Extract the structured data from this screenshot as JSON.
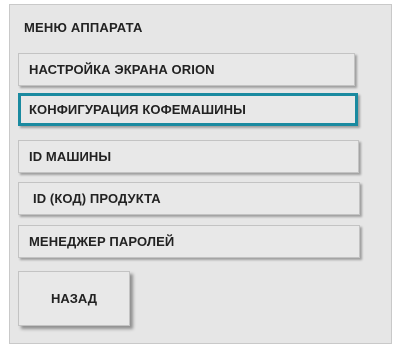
{
  "menu": {
    "title": "МЕНЮ АППАРАТА",
    "items": [
      {
        "label": "НАСТРОЙКА ЭКРАНА ORION",
        "selected": false
      },
      {
        "label": "КОНФИГУРАЦИЯ КОФЕМАШИНЫ",
        "selected": true
      },
      {
        "label": "ID МАШИНЫ",
        "selected": false
      },
      {
        "label": "ID (КОД) ПРОДУКТА",
        "selected": false
      },
      {
        "label": "МЕНЕДЖЕР ПАРОЛЕЙ",
        "selected": false
      }
    ],
    "back_label": "НАЗАД"
  },
  "colors": {
    "selection_border": "#1a8aa0",
    "panel_background": "#e6e6e6",
    "button_background": "#e8e8e8"
  }
}
